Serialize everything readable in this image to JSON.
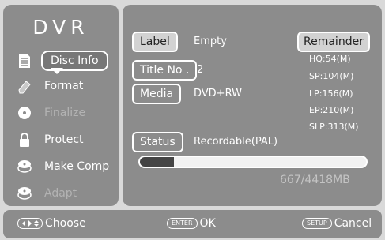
{
  "sidebar": {
    "logo": "DVR",
    "items": [
      {
        "label": "Disc Info",
        "icon": "document-icon",
        "active": true,
        "disabled": false
      },
      {
        "label": "Format",
        "icon": "eraser-icon",
        "active": false,
        "disabled": false
      },
      {
        "label": "Finalize",
        "icon": "disc-icon",
        "active": false,
        "disabled": true
      },
      {
        "label": "Protect",
        "icon": "lock-icon",
        "active": false,
        "disabled": false
      },
      {
        "label": "Make Comp",
        "icon": "disc-stack-icon",
        "active": false,
        "disabled": false
      },
      {
        "label": "Adapt",
        "icon": "disc-stack-icon",
        "active": false,
        "disabled": true
      }
    ]
  },
  "info": {
    "label_btn": "Label",
    "label_value": "Empty",
    "title_btn": "Title No .",
    "title_value": "2",
    "media_btn": "Media",
    "media_value": "DVD+RW",
    "status_btn": "Status",
    "status_value": "Recordable(PAL)"
  },
  "remainder": {
    "button": "Remainder",
    "lines": [
      "HQ:54(M)",
      "SP:104(M)",
      "LP:156(M)",
      "EP:210(M)",
      "SLP:313(M)"
    ]
  },
  "capacity": {
    "used_mb": 667,
    "total_mb": 4418,
    "text": "667/4418MB"
  },
  "footer": {
    "choose": "Choose",
    "enter_key": "ENTER",
    "ok": "OK",
    "setup_key": "SETUP",
    "cancel": "Cancel"
  }
}
